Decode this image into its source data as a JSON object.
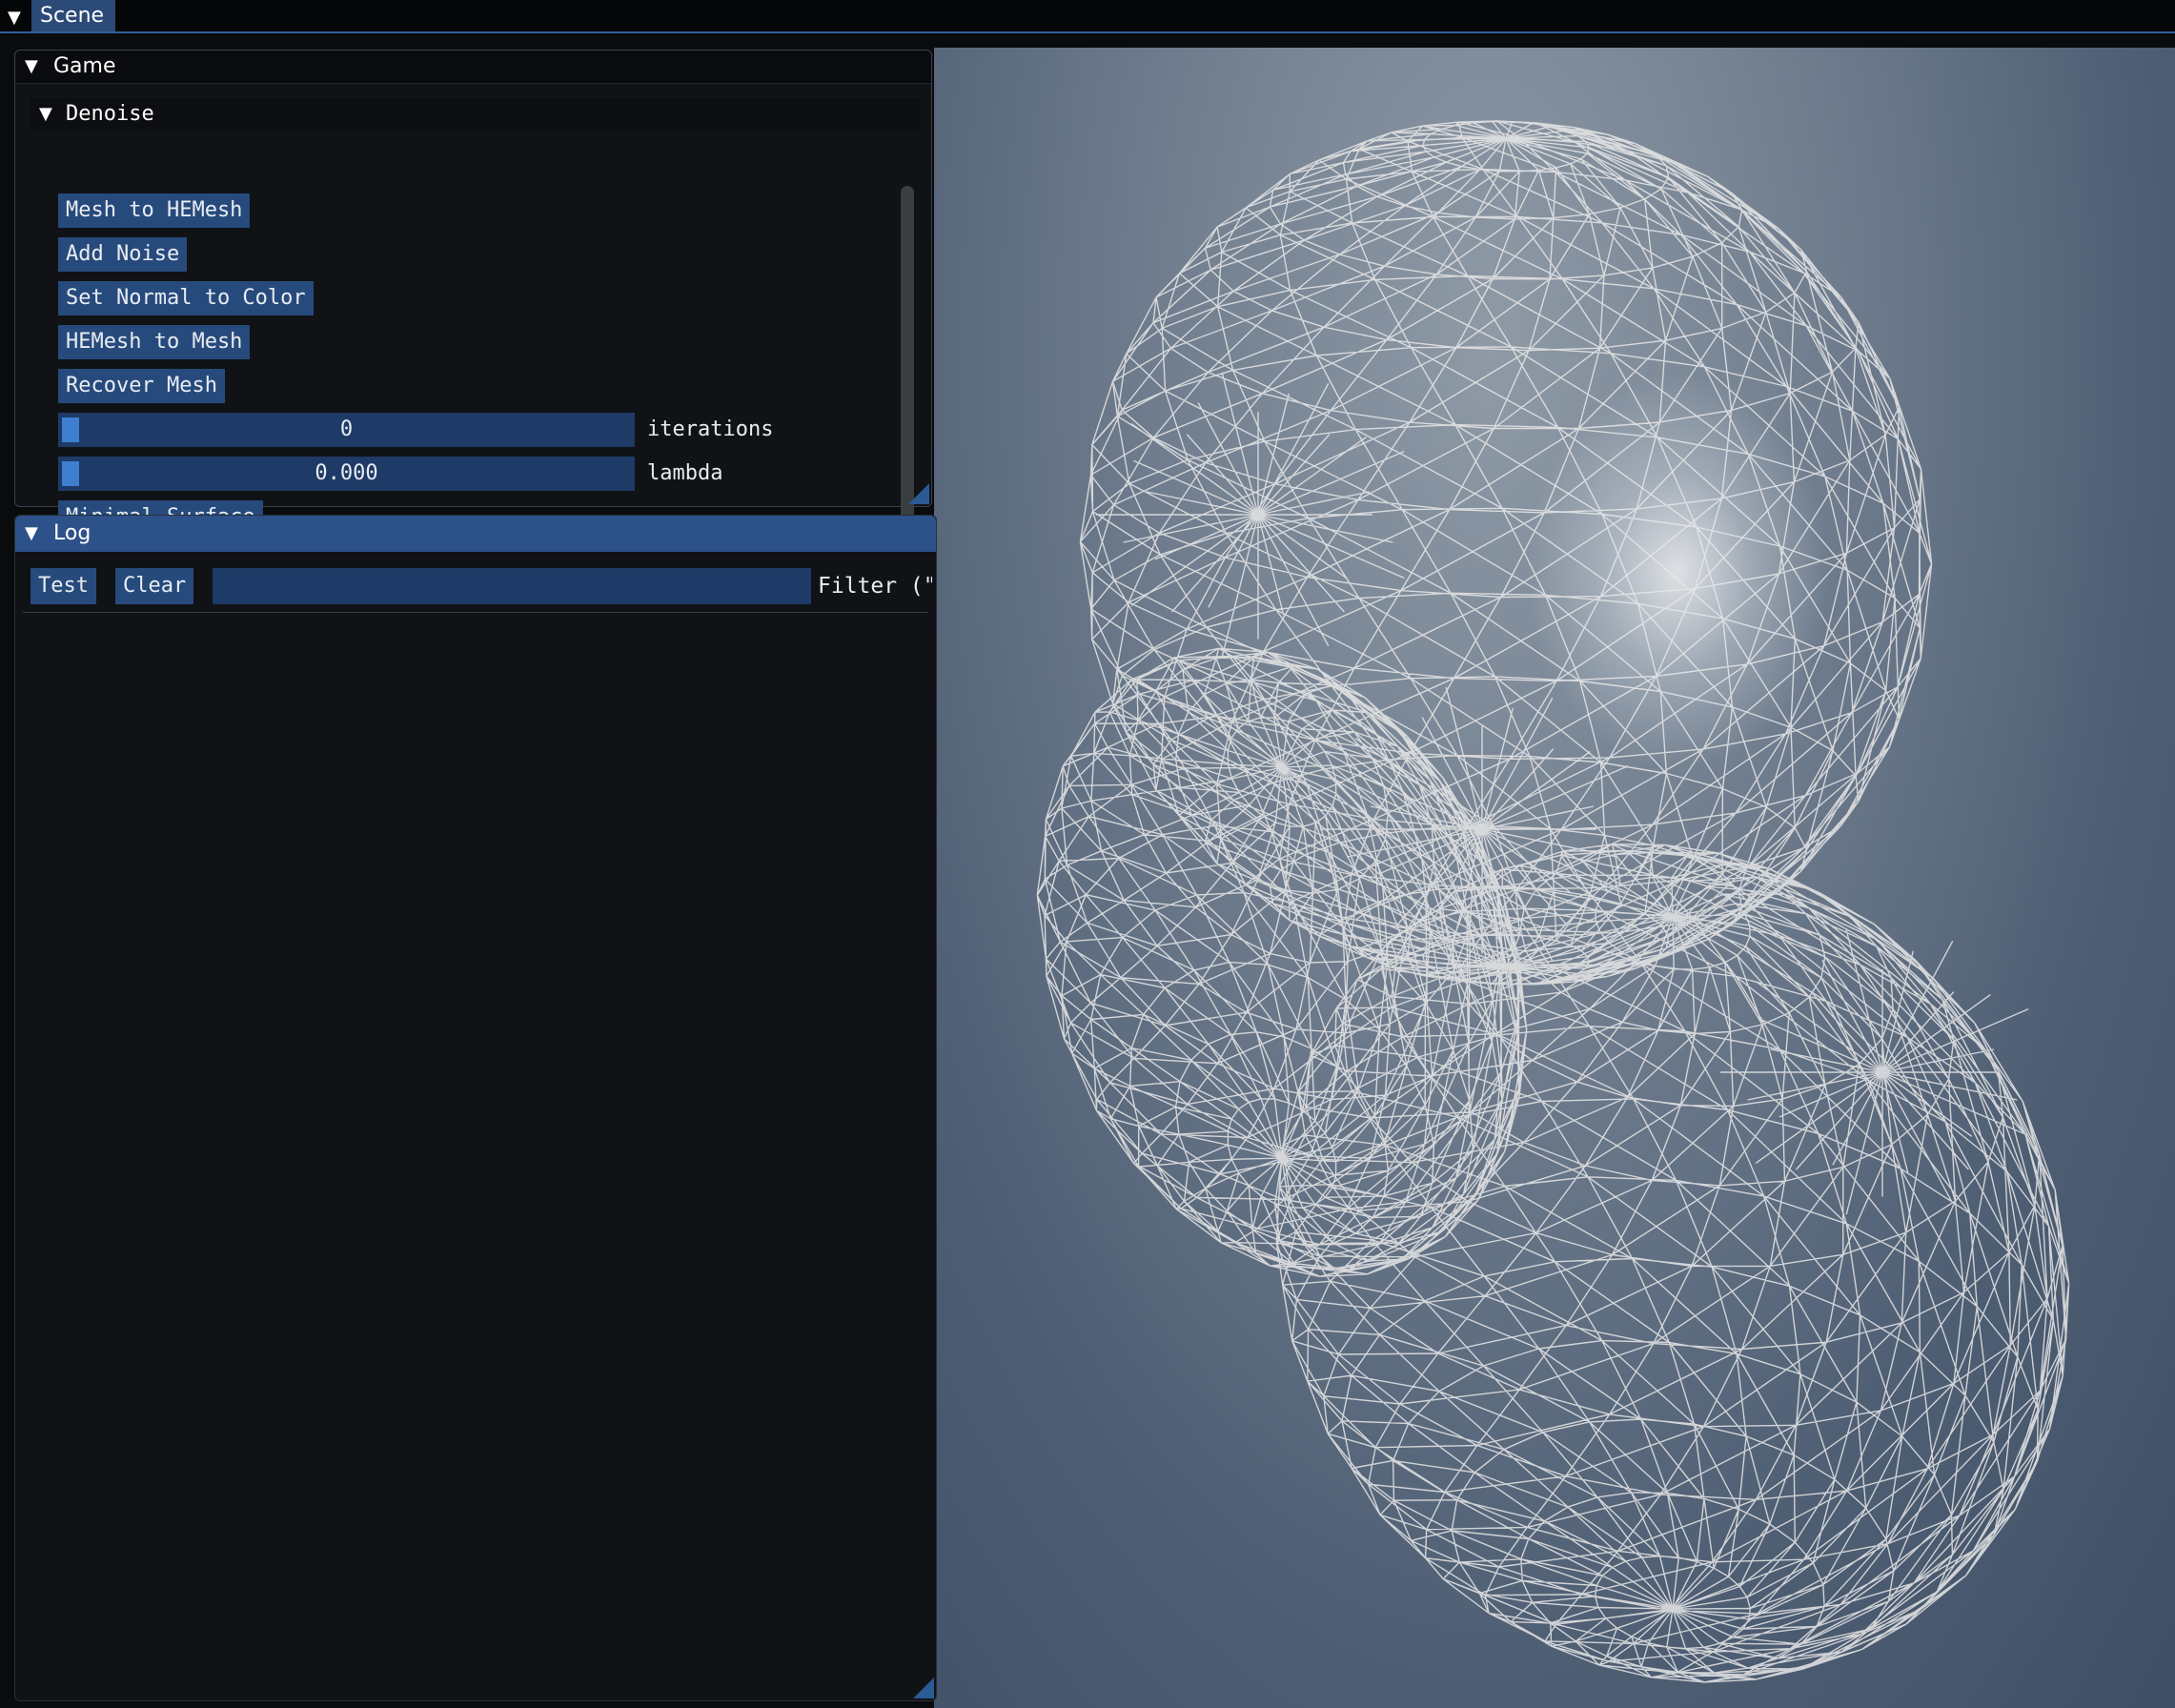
{
  "topbar": {
    "scene_label": "Scene"
  },
  "game": {
    "title": "Game",
    "denoise": {
      "title": "Denoise",
      "buttons": {
        "mesh_to_hemesh": "Mesh to HEMesh",
        "add_noise": "Add Noise",
        "set_normal_to_color": "Set Normal to Color",
        "hemesh_to_mesh": "HEMesh to Mesh",
        "recover_mesh": "Recover Mesh",
        "minimal_surface": "Minimal Surface"
      },
      "iterations": {
        "value": "0",
        "label": "iterations"
      },
      "lambda": {
        "value": "0.000",
        "label": "lambda"
      }
    }
  },
  "log": {
    "title": "Log",
    "test_label": "Test",
    "clear_label": "Clear",
    "filter_value": "",
    "filter_label": "Filter (\"inc"
  },
  "colors": {
    "accent": "#2d5189",
    "button": "#274a7c",
    "frame": "#1e3a66",
    "grab": "#3f7fd0",
    "panel_bg": "#101216",
    "wireframe": "#e8e8e8"
  }
}
